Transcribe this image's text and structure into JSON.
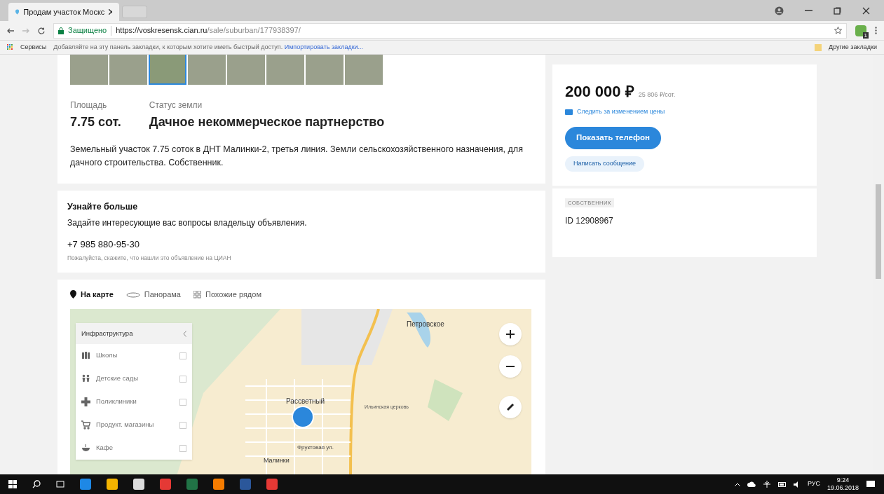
{
  "browser": {
    "tab_title": "Продам участок Москс",
    "secure_label": "Защищено",
    "url_host": "https://voskresensk.cian.ru",
    "url_path": "/sale/suburban/177938397/",
    "apps_label": "Сервисы",
    "bookmarks_hint": "Добавляйте на эту панель закладки, к которым хотите иметь быстрый доступ.",
    "bookmarks_import": "Импортировать закладки...",
    "other_bookmarks": "Другие закладки",
    "extension_badge": "1"
  },
  "thumbnails": [
    {
      "selected": false
    },
    {
      "selected": false
    },
    {
      "selected": true
    },
    {
      "selected": false
    },
    {
      "selected": false
    },
    {
      "selected": false
    },
    {
      "selected": false
    },
    {
      "selected": false
    }
  ],
  "facts": [
    {
      "label": "Площадь",
      "value": "7.75 сот."
    },
    {
      "label": "Статус земли",
      "value": "Дачное некоммерческое партнерство"
    }
  ],
  "description": "Земельный участок 7.75 соток в ДНТ Малинки-2, третья линия. Земли сельскохозяйственного назначения, для дачного строительства. Собственник.",
  "contact": {
    "title": "Узнайте больше",
    "text": "Задайте интересующие вас вопросы владельцу объявления.",
    "phone": "+7 985 880-95-30",
    "note": "Пожалуйста, скажите, что нашли это объявление на ЦИАН"
  },
  "map_tabs": [
    {
      "label": "На карте",
      "selected": true
    },
    {
      "label": "Панорама",
      "selected": false
    },
    {
      "label": "Похожие рядом",
      "selected": false
    }
  ],
  "infrastructure": {
    "title": "Инфраструктура",
    "items": [
      {
        "label": "Школы",
        "checked": false
      },
      {
        "label": "Детские сады",
        "checked": false
      },
      {
        "label": "Поликлиники",
        "checked": false
      },
      {
        "label": "Продукт. магазины",
        "checked": false
      },
      {
        "label": "Кафе",
        "checked": false
      }
    ]
  },
  "map_labels": [
    "Петровское",
    "Рассветный",
    "Ильинская церковь",
    "Фруктовая ул.",
    "Малинки"
  ],
  "price": {
    "value": "200 000 ₽",
    "per_unit": "25 806 ₽/сот.",
    "watch": "Следить за изменением цены",
    "show_phone": "Показать телефон",
    "message": "Написать сообщение"
  },
  "owner": {
    "badge": "СОБСТВЕННИК",
    "id": "ID 12908967"
  },
  "taskbar": {
    "language": "РУС",
    "time": "9:24",
    "date": "19.06.2018"
  }
}
